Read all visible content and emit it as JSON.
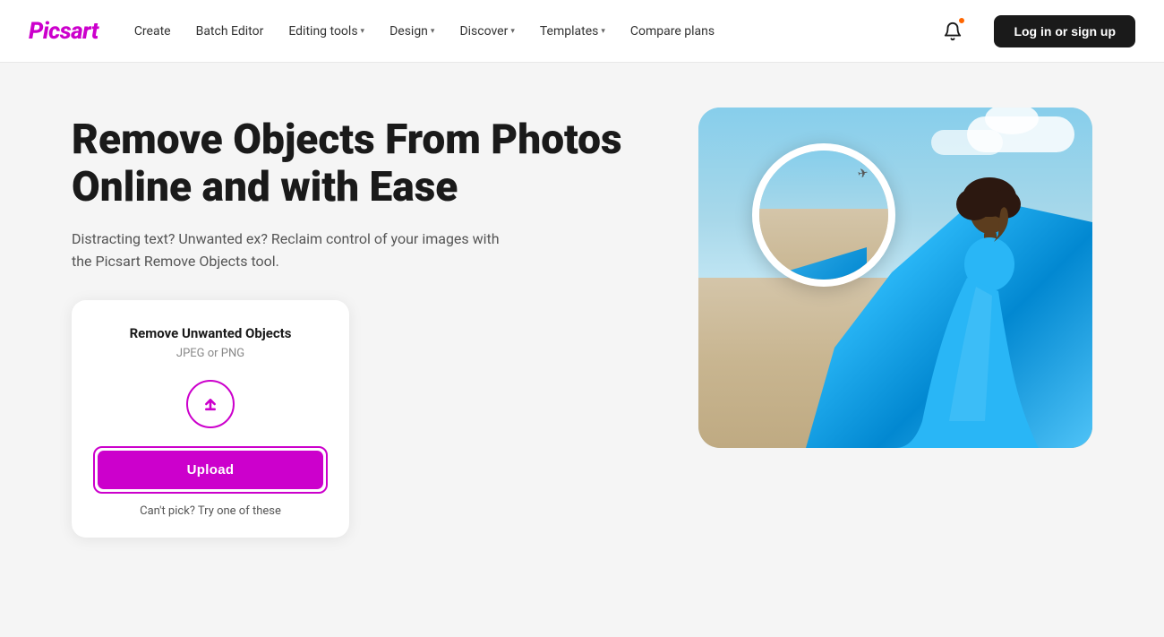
{
  "brand": {
    "logo_text": "Picsart"
  },
  "navbar": {
    "links": [
      {
        "id": "create",
        "label": "Create",
        "has_dropdown": false
      },
      {
        "id": "batch-editor",
        "label": "Batch Editor",
        "has_dropdown": false
      },
      {
        "id": "editing-tools",
        "label": "Editing tools",
        "has_dropdown": true
      },
      {
        "id": "design",
        "label": "Design",
        "has_dropdown": true
      },
      {
        "id": "discover",
        "label": "Discover",
        "has_dropdown": true
      },
      {
        "id": "templates",
        "label": "Templates",
        "has_dropdown": true
      },
      {
        "id": "compare-plans",
        "label": "Compare plans",
        "has_dropdown": false
      }
    ],
    "login_button_label": "Log in or sign up"
  },
  "hero": {
    "title": "Remove Objects From Photos Online and with Ease",
    "subtitle": "Distracting text? Unwanted ex? Reclaim control of your images with the Picsart Remove Objects tool.",
    "upload_card": {
      "title": "Remove Unwanted Objects",
      "file_types": "JPEG or PNG",
      "upload_button_label": "Upload",
      "cant_pick_text": "Can't pick? Try one of these"
    }
  },
  "icons": {
    "bell": "🔔",
    "upload_arrow": "↑",
    "chevron_down": "▾",
    "airplane": "✈"
  },
  "colors": {
    "brand_purple": "#cc00cc",
    "dark": "#1a1a1a",
    "button_bg": "#1a1a1a",
    "sky_blue": "#87CEEB",
    "dress_blue": "#29b6f6"
  }
}
